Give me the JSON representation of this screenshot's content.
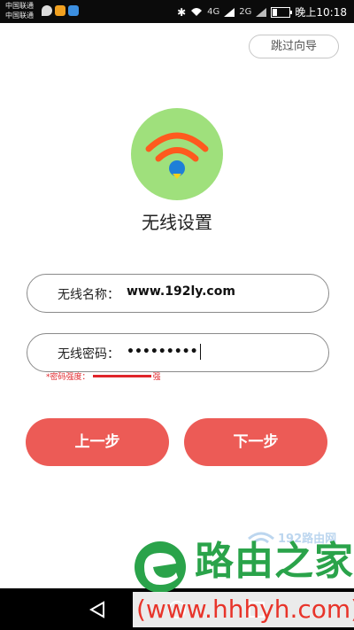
{
  "status_bar": {
    "carrier1": "中国联通",
    "carrier2": "中国联通",
    "signal1_label": "4G",
    "signal2_label": "2G",
    "time": "晚上10:18"
  },
  "skip_label": "跳过向导",
  "title": "无线设置",
  "ssid": {
    "label": "无线名称：",
    "value": "www.192ly.com"
  },
  "password": {
    "label": "无线密码：",
    "masked": "•••••••••"
  },
  "strength": {
    "label": "*密码强度：",
    "level": "强"
  },
  "buttons": {
    "prev": "上一步",
    "next": "下一步"
  },
  "watermark": {
    "small": "192路由网",
    "brand": "路由之家",
    "url": "(www.hhhyh.com)"
  },
  "colors": {
    "accent": "#ec5b56",
    "logo_bg": "#9fe07c",
    "strength": "#e0252a"
  }
}
